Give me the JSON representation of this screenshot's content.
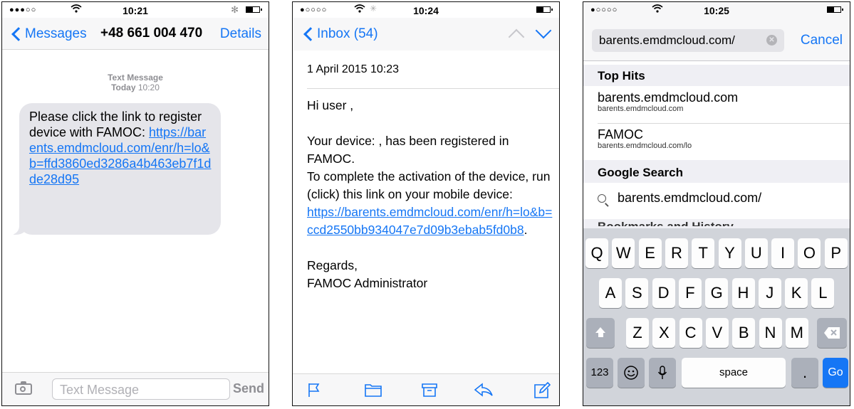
{
  "phone1": {
    "status": {
      "signal": "●●●○○",
      "time": "10:21",
      "bluetooth": "✻"
    },
    "nav": {
      "back": "Messages",
      "contact": "+48 661 004 470",
      "details": "Details"
    },
    "meta": {
      "type": "Text Message",
      "day": "Today",
      "time": "10:20"
    },
    "bubble": {
      "text": "Please click the link to register device with FAMOC: ",
      "link": "https://barents.emdmcloud.com/enr/h=lo&b=ffd3860ed3286a4b463eb7f1dde28d95"
    },
    "compose": {
      "placeholder": "Text Message",
      "send": "Send"
    }
  },
  "phone2": {
    "status": {
      "signal": "●○○○○",
      "time": "10:24"
    },
    "nav": {
      "back": "Inbox (54)"
    },
    "date": "1 April 2015 10:23",
    "greeting": "Hi user ,",
    "line1": "Your device: , has been registered in FAMOC.",
    "line2": "To complete the activation of the device, run (click) this link on your mobile device:",
    "link": "https://barents.emdmcloud.com/enr/h=lo&b=ccd2550bb934047e7d09b3ebab5fd0b8",
    "link_suffix": ".",
    "regards": "Regards,",
    "signature": "FAMOC Administrator"
  },
  "phone3": {
    "status": {
      "signal": "●○○○○",
      "time": "10:25"
    },
    "url": "barents.emdmcloud.com/",
    "cancel": "Cancel",
    "top_hits_label": "Top Hits",
    "hits": [
      {
        "title": "barents.emdmcloud.com",
        "sub": "barents.emdmcloud.com"
      },
      {
        "title": "FAMOC",
        "sub": "barents.emdmcloud.com/lo"
      }
    ],
    "google_label": "Google Search",
    "google_query": "barents.emdmcloud.com/",
    "partial_section": "Bookmarks and History",
    "keyboard": {
      "row1": [
        "Q",
        "W",
        "E",
        "R",
        "T",
        "Y",
        "U",
        "I",
        "O",
        "P"
      ],
      "row2": [
        "A",
        "S",
        "D",
        "F",
        "G",
        "H",
        "J",
        "K",
        "L"
      ],
      "row3": [
        "Z",
        "X",
        "C",
        "V",
        "B",
        "N",
        "M"
      ],
      "numbers": "123",
      "space": "space",
      "dot": ".",
      "go": "Go"
    }
  }
}
